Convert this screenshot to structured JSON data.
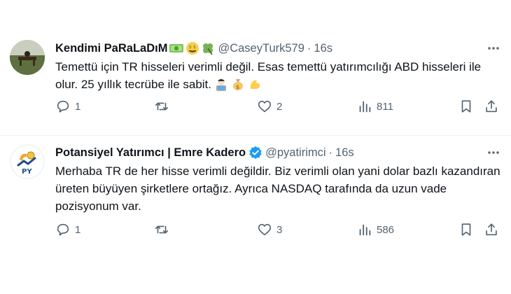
{
  "tweets": [
    {
      "author_name": "Kendimi PaRaLaDıM",
      "author_emojis": [
        "money-bills-emoji",
        "money-mouth-face-emoji",
        "four-leaf-clover-emoji"
      ],
      "handle": "@CaseyTurk579",
      "dot": "·",
      "time": "16s",
      "text": "Temettü için TR hisseleri verimli değil. Esas temettü yatırımcılığı ABD hisseleri ile olur. 25 yıllık tecrübe ile sabit.",
      "text_emojis": [
        "man-technologist-emoji",
        "money-bag-emoji",
        "flexed-biceps-emoji"
      ],
      "replies": "1",
      "reposts": "",
      "likes": "2",
      "views": "811"
    },
    {
      "author_name": "Potansiyel Yatırımcı | Emre Kadero",
      "verified": true,
      "handle": "@pyatirimci",
      "dot": "·",
      "time": "16s",
      "text": "Merhaba TR de her hisse verimli değildir. Biz verimli olan yani dolar bazlı kazandıran üreten büyüyen şirketlere ortağız. Ayrıca NASDAQ tarafında da uzun vade pozisyonum var.",
      "replies": "1",
      "reposts": "",
      "likes": "3",
      "views": "586"
    }
  ],
  "colors": {
    "text": "#0f1419",
    "secondary": "#536471",
    "verified": "#1d9bf0",
    "divider": "#eff3f4"
  }
}
